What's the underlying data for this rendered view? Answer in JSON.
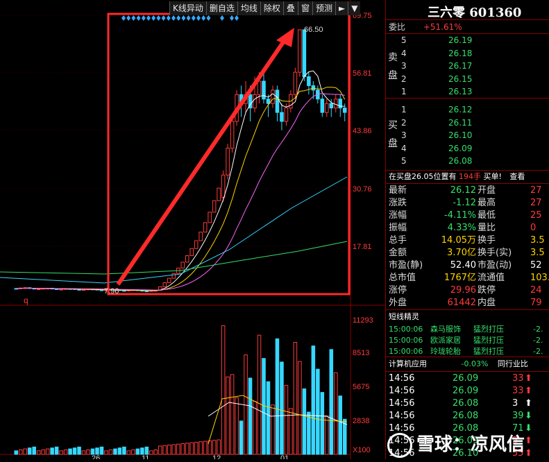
{
  "toolbar": {
    "buttons": [
      "K线异动",
      "删自选",
      "均线",
      "除权",
      "叠",
      "窗",
      "预测"
    ],
    "play_icon": "►",
    "menu_icon": "▼"
  },
  "chart": {
    "price_axis": [
      "69.75",
      "56.81",
      "43.86",
      "30.76",
      "17.81"
    ],
    "volume_axis": [
      "11293",
      "8513",
      "5675",
      "2838",
      "X100"
    ],
    "high_label": "66.50",
    "low_label": "7.96",
    "marker_q": "q",
    "bottom_axis": [
      "26",
      "11",
      "12",
      "01"
    ],
    "colors": {
      "up": "#ff3b3b",
      "down": "#36d8ff",
      "ma5": "#ffffff",
      "ma10": "#ffd400",
      "ma20": "#ff66ff",
      "ma60": "#36d8ff",
      "ma120": "#35e06a",
      "box": "#ff2a2a"
    }
  },
  "stock": {
    "name": "三六零",
    "code": "601360"
  },
  "weibi": {
    "label": "委比",
    "value": "+51.61%"
  },
  "sell": {
    "label": "卖盘",
    "levels": [
      {
        "n": "5",
        "price": "26.19"
      },
      {
        "n": "4",
        "price": "26.18"
      },
      {
        "n": "3",
        "price": "26.17"
      },
      {
        "n": "2",
        "price": "26.15"
      },
      {
        "n": "1",
        "price": "26.13"
      }
    ]
  },
  "buy": {
    "label": "买盘",
    "levels": [
      {
        "n": "1",
        "price": "26.12"
      },
      {
        "n": "2",
        "price": "26.11"
      },
      {
        "n": "3",
        "price": "26.10"
      },
      {
        "n": "4",
        "price": "26.09"
      },
      {
        "n": "5",
        "price": "26.08"
      }
    ]
  },
  "notice": {
    "text1": "在买盘26.05位置有",
    "qty": "194手",
    "text2": "买单!",
    "link": "查看"
  },
  "quote": [
    {
      "l": "最新",
      "v": "26.12",
      "l2": "开盘",
      "v2": "27",
      "c": "green"
    },
    {
      "l": "涨跌",
      "v": "-1.12",
      "l2": "最高",
      "v2": "27",
      "c": "green"
    },
    {
      "l": "涨幅",
      "v": "-4.11%",
      "l2": "最低",
      "v2": "25",
      "c": "green"
    },
    {
      "l": "振幅",
      "v": "4.33%",
      "l2": "量比",
      "v2": "0",
      "c": "green"
    },
    {
      "l": "总手",
      "v": "14.05万",
      "l2": "换手",
      "v2": "3.5",
      "c": "yellow"
    },
    {
      "l": "金额",
      "v": "3.70亿",
      "l2": "换手(实)",
      "v2": "3.5",
      "c": "yellow"
    },
    {
      "l": "市盈(静)",
      "v": "52.40",
      "l2": "市盈(动)",
      "v2": "52",
      "c": "white"
    },
    {
      "l": "总市值",
      "v": "1767亿",
      "l2": "流通值",
      "v2": "103.",
      "c": "yellow"
    },
    {
      "l": "涨停",
      "v": "29.96",
      "l2": "跌停",
      "v2": "24",
      "c": "red"
    },
    {
      "l": "外盘",
      "v": "61442",
      "l2": "内盘",
      "v2": "79",
      "c": "red"
    }
  ],
  "elves": {
    "title": "短线精灵",
    "rows": [
      {
        "t": "15:00:06",
        "name": "森马服饰",
        "act": "猛烈打压",
        "v": "-2."
      },
      {
        "t": "15:00:06",
        "name": "欧派家居",
        "act": "猛烈打压",
        "v": "-2."
      },
      {
        "t": "15:00:06",
        "name": "玲珑轮胎",
        "act": "猛烈打压",
        "v": "-2."
      }
    ]
  },
  "sector": {
    "name": "计算机应用",
    "pct": "-0.03%",
    "peers": "同行业比"
  },
  "ticks": [
    {
      "t": "14:56",
      "p": "26.09",
      "q": "33",
      "dir": "up"
    },
    {
      "t": "14:56",
      "p": "26.09",
      "q": "33",
      "dir": "up"
    },
    {
      "t": "14:56",
      "p": "26.08",
      "q": "3",
      "dir": "up-white"
    },
    {
      "t": "14:56",
      "p": "26.08",
      "q": "39",
      "dir": "down"
    },
    {
      "t": "14:56",
      "p": "26.08",
      "q": "71",
      "dir": "down"
    },
    {
      "t": "14:56",
      "p": "26.09",
      "q": "5",
      "dir": "up"
    },
    {
      "t": "14:56",
      "p": "26.10",
      "q": "55",
      "dir": "up"
    }
  ],
  "watermark": {
    "text": "雪球：凉风信"
  }
}
